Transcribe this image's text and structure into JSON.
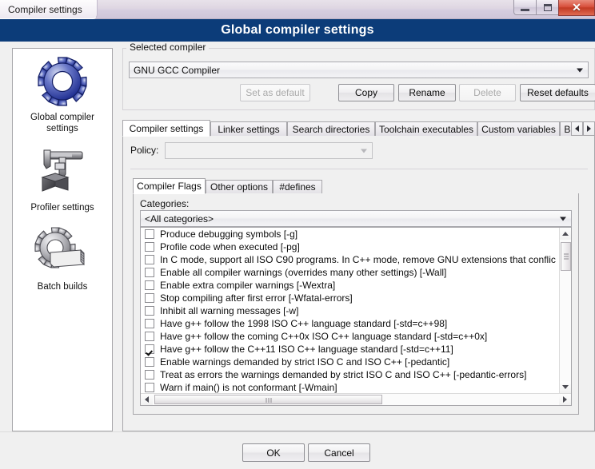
{
  "window": {
    "title": "Compiler settings",
    "banner_title": "Global compiler settings",
    "controls": {
      "minimize": "minimize-icon",
      "maximize": "maximize-icon",
      "close": "✕"
    }
  },
  "sidebar": {
    "items": [
      {
        "label": "Global compiler settings",
        "icon": "gear-icon",
        "selected": true
      },
      {
        "label": "Profiler settings",
        "icon": "caliper-icon",
        "selected": false
      },
      {
        "label": "Batch builds",
        "icon": "gear-stack-icon",
        "selected": false
      }
    ]
  },
  "selected_compiler": {
    "group_label": "Selected compiler",
    "value": "GNU GCC Compiler",
    "buttons": [
      {
        "label": "Set as default",
        "enabled": false
      },
      {
        "label": "Copy",
        "enabled": true
      },
      {
        "label": "Rename",
        "enabled": true
      },
      {
        "label": "Delete",
        "enabled": false
      },
      {
        "label": "Reset defaults",
        "enabled": true
      }
    ]
  },
  "tabs": {
    "items": [
      {
        "label": "Compiler settings",
        "active": true
      },
      {
        "label": "Linker settings",
        "active": false
      },
      {
        "label": "Search directories",
        "active": false
      },
      {
        "label": "Toolchain executables",
        "active": false
      },
      {
        "label": "Custom variables",
        "active": false
      },
      {
        "label": "Bui",
        "active": false
      }
    ],
    "scroll_left": "◂",
    "scroll_right": "▸"
  },
  "policy": {
    "label": "Policy:",
    "value": "",
    "enabled": false
  },
  "inner_tabs": {
    "items": [
      {
        "label": "Compiler Flags",
        "active": true
      },
      {
        "label": "Other options",
        "active": false
      },
      {
        "label": "#defines",
        "active": false
      }
    ]
  },
  "categories": {
    "label": "Categories:",
    "value": "<All categories>"
  },
  "flags": [
    {
      "label": "Produce debugging symbols  [-g]",
      "checked": false
    },
    {
      "label": "Profile code when executed  [-pg]",
      "checked": false
    },
    {
      "label": "In C mode, support all ISO C90 programs. In C++ mode, remove GNU extensions that conflic",
      "checked": false
    },
    {
      "label": "Enable all compiler warnings (overrides many other settings)  [-Wall]",
      "checked": false
    },
    {
      "label": "Enable extra compiler warnings  [-Wextra]",
      "checked": false
    },
    {
      "label": "Stop compiling after first error  [-Wfatal-errors]",
      "checked": false
    },
    {
      "label": "Inhibit all warning messages  [-w]",
      "checked": false
    },
    {
      "label": "Have g++ follow the 1998 ISO C++ language standard  [-std=c++98]",
      "checked": false
    },
    {
      "label": "Have g++ follow the coming C++0x ISO C++ language standard  [-std=c++0x]",
      "checked": false
    },
    {
      "label": "Have g++ follow the C++11 ISO C++ language standard  [-std=c++11]",
      "checked": true
    },
    {
      "label": "Enable warnings demanded by strict ISO C and ISO C++  [-pedantic]",
      "checked": false
    },
    {
      "label": "Treat as errors the warnings demanded by strict ISO C and ISO C++  [-pedantic-errors]",
      "checked": false
    },
    {
      "label": "Warn if main() is not conformant  [-Wmain]",
      "checked": false
    }
  ],
  "footer": {
    "ok": "OK",
    "cancel": "Cancel"
  },
  "colors": {
    "banner": "#0c3c79",
    "close_button": "#c23a24",
    "window_bg": "#f0f0f0",
    "gear_blue": "#2a3f9e"
  }
}
